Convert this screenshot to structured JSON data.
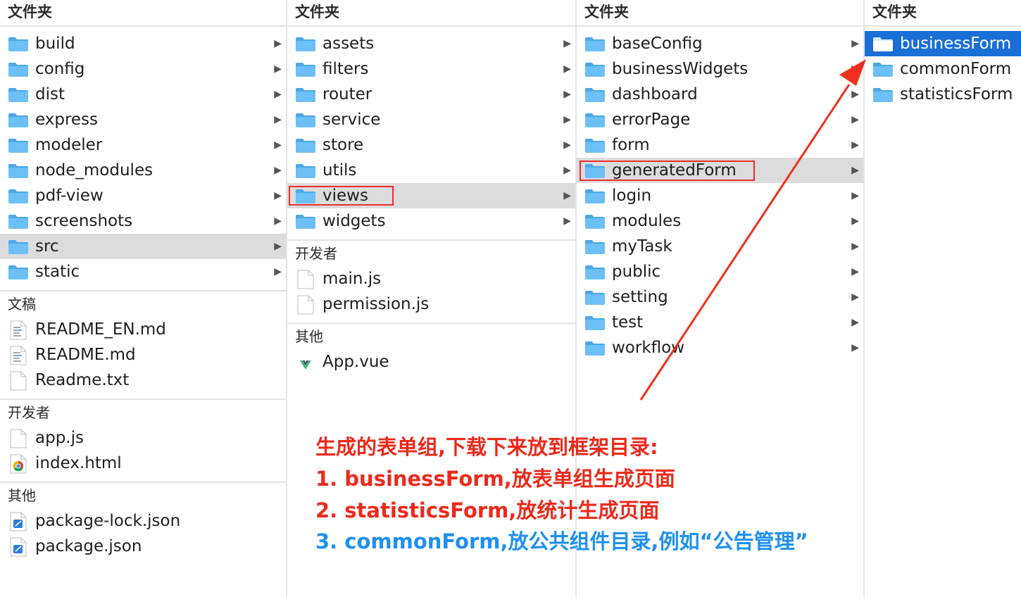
{
  "columns": [
    {
      "header": "文件夹",
      "folders": [
        {
          "label": "build"
        },
        {
          "label": "config"
        },
        {
          "label": "dist"
        },
        {
          "label": "express"
        },
        {
          "label": "modeler"
        },
        {
          "label": "node_modules"
        },
        {
          "label": "pdf-view"
        },
        {
          "label": "screenshots"
        },
        {
          "label": "src",
          "selected": true
        },
        {
          "label": "static"
        }
      ],
      "sections": [
        {
          "header": "文稿",
          "files": [
            {
              "label": "README_EN.md",
              "icon": "text-doc-icon"
            },
            {
              "label": "README.md",
              "icon": "text-doc-icon"
            },
            {
              "label": "Readme.txt",
              "icon": "blank-doc-icon"
            }
          ]
        },
        {
          "header": "开发者",
          "files": [
            {
              "label": "app.js",
              "icon": "blank-doc-icon"
            },
            {
              "label": "index.html",
              "icon": "chrome-doc-icon"
            }
          ]
        },
        {
          "header": "其他",
          "files": [
            {
              "label": "package-lock.json",
              "icon": "xcode-doc-icon"
            },
            {
              "label": "package.json",
              "icon": "xcode-doc-icon"
            }
          ]
        }
      ]
    },
    {
      "header": "文件夹",
      "folders": [
        {
          "label": "assets"
        },
        {
          "label": "filters"
        },
        {
          "label": "router"
        },
        {
          "label": "service"
        },
        {
          "label": "store"
        },
        {
          "label": "utils"
        },
        {
          "label": "views",
          "selected": true
        },
        {
          "label": "widgets"
        }
      ],
      "sections": [
        {
          "header": "开发者",
          "files": [
            {
              "label": "main.js",
              "icon": "blank-doc-icon"
            },
            {
              "label": "permission.js",
              "icon": "blank-doc-icon"
            }
          ]
        },
        {
          "header": "其他",
          "files": [
            {
              "label": "App.vue",
              "icon": "vue-doc-icon"
            }
          ]
        }
      ]
    },
    {
      "header": "文件夹",
      "folders": [
        {
          "label": "baseConfig"
        },
        {
          "label": "businessWidgets"
        },
        {
          "label": "dashboard"
        },
        {
          "label": "errorPage"
        },
        {
          "label": "form"
        },
        {
          "label": "generatedForm",
          "selected": true
        },
        {
          "label": "login"
        },
        {
          "label": "modules"
        },
        {
          "label": "myTask"
        },
        {
          "label": "public"
        },
        {
          "label": "setting"
        },
        {
          "label": "test"
        },
        {
          "label": "workflow"
        }
      ],
      "sections": []
    },
    {
      "header": "文件夹",
      "folders": [
        {
          "label": "businessForm",
          "active": true,
          "noArrow": true
        },
        {
          "label": "commonForm",
          "noArrow": true
        },
        {
          "label": "statisticsForm",
          "noArrow": true
        }
      ],
      "sections": []
    }
  ],
  "annotations": {
    "line1": "生成的表单组,下载下来放到框架目录:",
    "line2": "1. businessForm,放表单组生成页面",
    "line3": "2. statisticsForm,放统计生成页面",
    "line4": "3. commonForm,放公共组件目录,例如“公告管理”"
  },
  "colors": {
    "folder": "#6cc0f5",
    "selected_row": "#dcdcdc",
    "active_row": "#1a6ed6",
    "annotation_red": "#ec2a1c",
    "annotation_blue": "#1e90f0"
  },
  "icons": {
    "disclosure": "▶"
  }
}
